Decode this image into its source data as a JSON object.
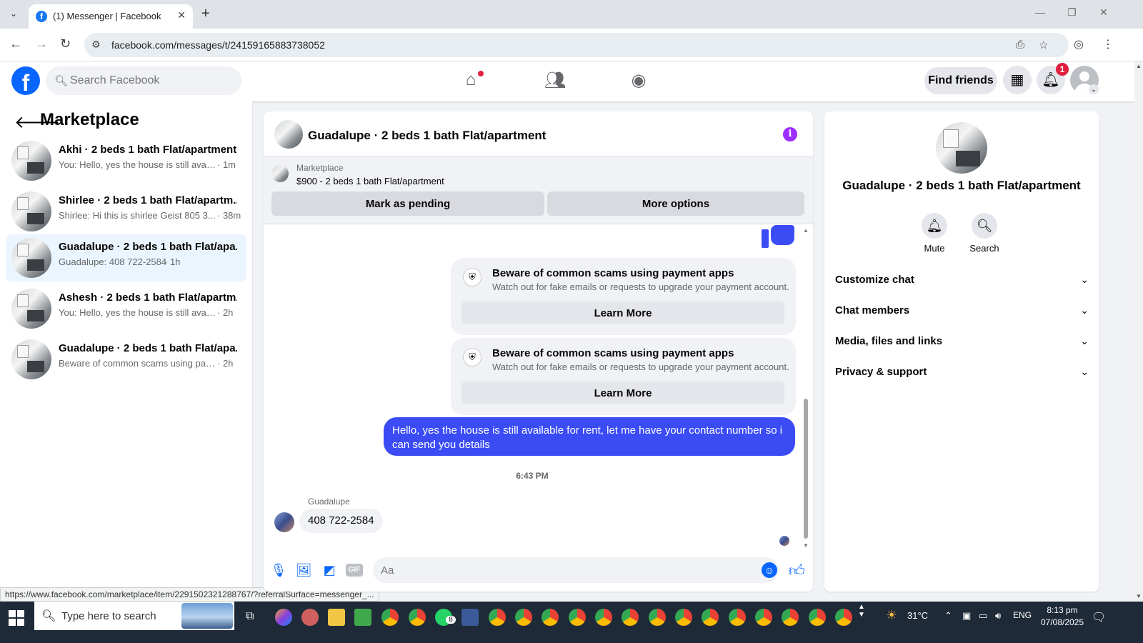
{
  "browser": {
    "tab_title": "(1) Messenger | Facebook",
    "favicon_letter": "f",
    "url": "facebook.com/messages/t/24159165883738052",
    "status_url": "https://www.facebook.com/marketplace/item/2291502321288767/?referralSurface=messenger_..."
  },
  "header": {
    "logo": "f",
    "search_placeholder": "Search Facebook",
    "find_friends": "Find friends",
    "notification_count": "1"
  },
  "sidebar": {
    "title": "Marketplace",
    "conversations": [
      {
        "name": "Akhi · 2 beds 1 bath Flat/apartment",
        "snippet": "You: Hello, yes the house is still availa...",
        "time": "· 1m"
      },
      {
        "name": "Shirlee · 2 beds 1 bath Flat/apartm...",
        "snippet": "Shirlee: Hi this is shirlee Geist 805 3...",
        "time": "· 38m"
      },
      {
        "name": "Guadalupe · 2 beds 1 bath Flat/apa...",
        "snippet": "Guadalupe: 408 722-2584",
        "time": "· 1h"
      },
      {
        "name": "Ashesh · 2 beds 1 bath Flat/apartm...",
        "snippet": "You: Hello, yes the house is still availa...",
        "time": "· 2h"
      },
      {
        "name": "Guadalupe · 2 beds 1 bath Flat/apa...",
        "snippet": "Beware of common scams using pay...",
        "time": "· 2h"
      }
    ]
  },
  "chat": {
    "title": "Guadalupe · 2 beds 1 bath Flat/apartment",
    "marketplace_label": "Marketplace",
    "listing": "$900 - 2 beds 1 bath Flat/apartment",
    "mark_pending": "Mark as pending",
    "more_options": "More options",
    "scam_notices": [
      {
        "title": "Beware of common scams using payment apps",
        "text": "Watch out for fake emails or requests to upgrade your payment account.",
        "button": "Learn More"
      },
      {
        "title": "Beware of common scams using payment apps",
        "text": "Watch out for fake emails or requests to upgrade your payment account.",
        "button": "Learn More"
      }
    ],
    "outgoing_message": "Hello, yes the house is still available for rent, let me have your contact number so i can send you details",
    "timestamp": "6:43 PM",
    "sender": "Guadalupe",
    "incoming_message": "408 722-2584",
    "composer_placeholder": "Aa"
  },
  "details": {
    "name": "Guadalupe · 2 beds 1 bath Flat/apartment",
    "mute": "Mute",
    "search": "Search",
    "sections": [
      "Customize chat",
      "Chat members",
      "Media, files and links",
      "Privacy & support"
    ]
  },
  "taskbar": {
    "search_text": "Type here to search",
    "temperature": "31°C",
    "language": "ENG",
    "time": "8:13 pm",
    "date": "07/08/2025",
    "whatsapp_badge": "8"
  }
}
